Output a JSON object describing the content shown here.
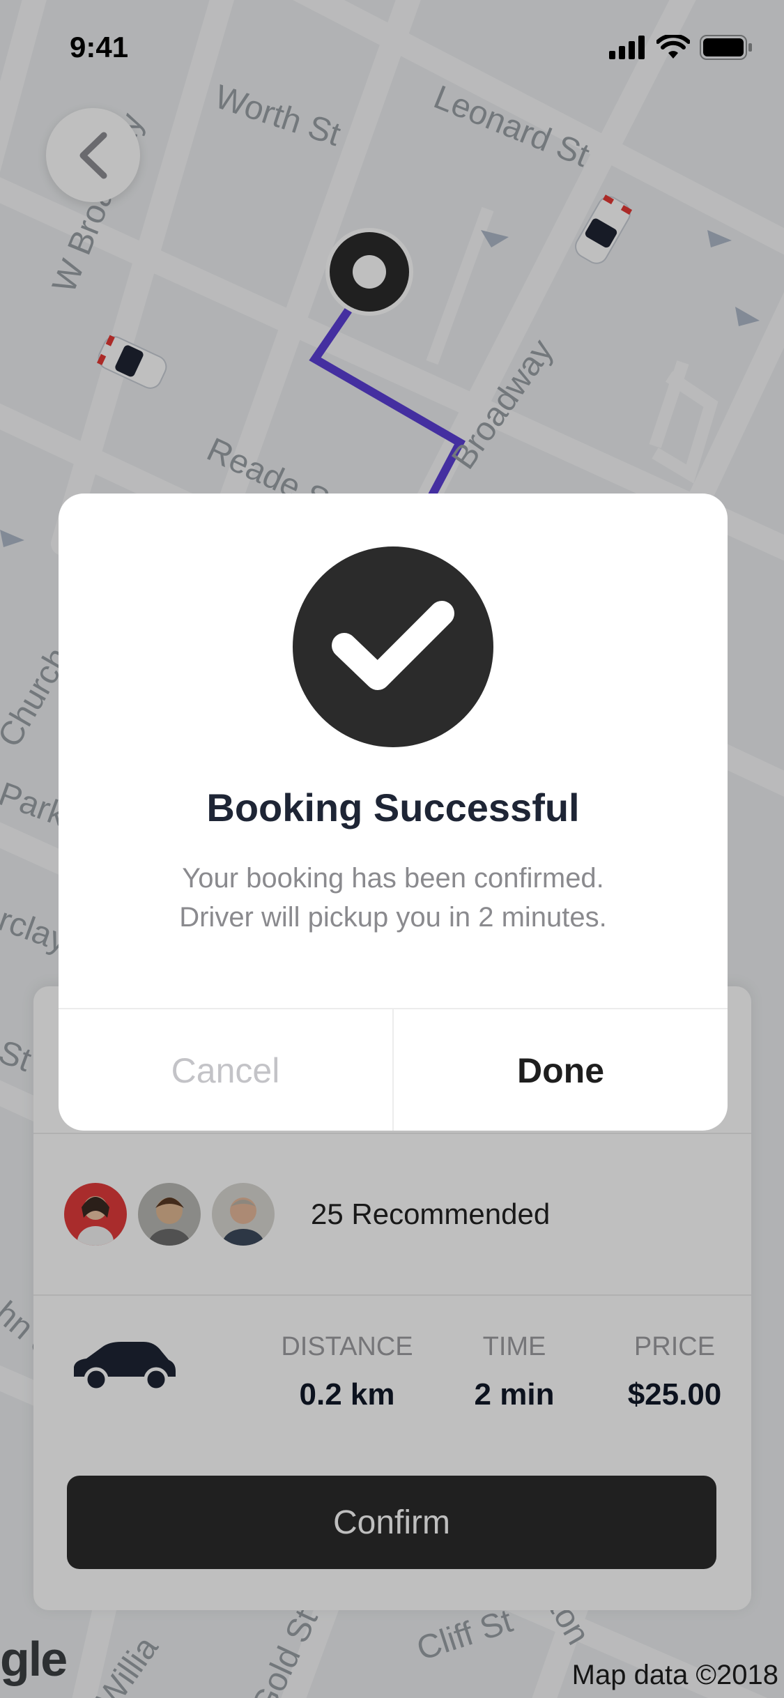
{
  "status_bar": {
    "time": "9:41"
  },
  "map": {
    "streets": [
      "Worth St",
      "Leonard St",
      "W Broadway",
      "Broadway",
      "Reade St",
      "Church",
      "Park",
      "rclay",
      "St",
      "hn S",
      "Willia",
      "Gold St",
      "Cliff St",
      "ton"
    ],
    "credit": "Map data ©2018",
    "logo": "gle",
    "route_color": "#5b3fd6"
  },
  "dialog": {
    "icon": "checkmark-icon",
    "title": "Booking Successful",
    "message_line1": "Your booking has been confirmed.",
    "message_line2": "Driver will pickup you in 2 minutes.",
    "cancel_label": "Cancel",
    "done_label": "Done"
  },
  "sheet": {
    "recommended_text": "25 Recommended",
    "trip": {
      "distance_label": "DISTANCE",
      "distance_value": "0.2 km",
      "time_label": "TIME",
      "time_value": "2 min",
      "price_label": "PRICE",
      "price_value": "$25.00"
    },
    "confirm_label": "Confirm"
  },
  "colors": {
    "dark": "#2b2b2b",
    "title": "#1e2535",
    "route": "#5b3fd6",
    "overlay": "rgba(0,0,0,0.25)"
  }
}
